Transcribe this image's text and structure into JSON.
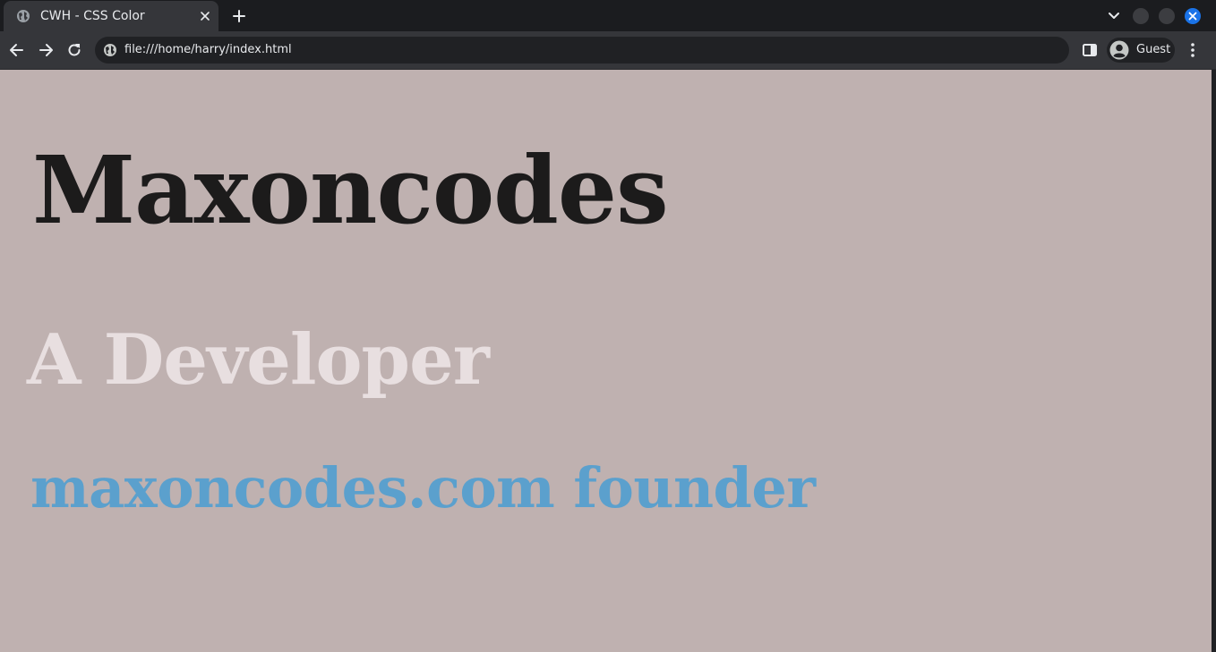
{
  "tab": {
    "title": "CWH - CSS Color",
    "favicon": "globe-icon"
  },
  "address_bar": {
    "url": "file:///home/harry/index.html",
    "site_icon": "globe-icon"
  },
  "profile": {
    "label": "Guest"
  },
  "page": {
    "background": "#bfb1b0",
    "heading": "Maxoncodes",
    "heading_color": "#1c1b1b",
    "subheading": "A Developer",
    "subheading_color": "#e8dfe0",
    "tagline": "maxoncodes.com founder",
    "tagline_color": "#5ba0cd"
  },
  "window_controls": {
    "close_color": "#1a73e8"
  }
}
